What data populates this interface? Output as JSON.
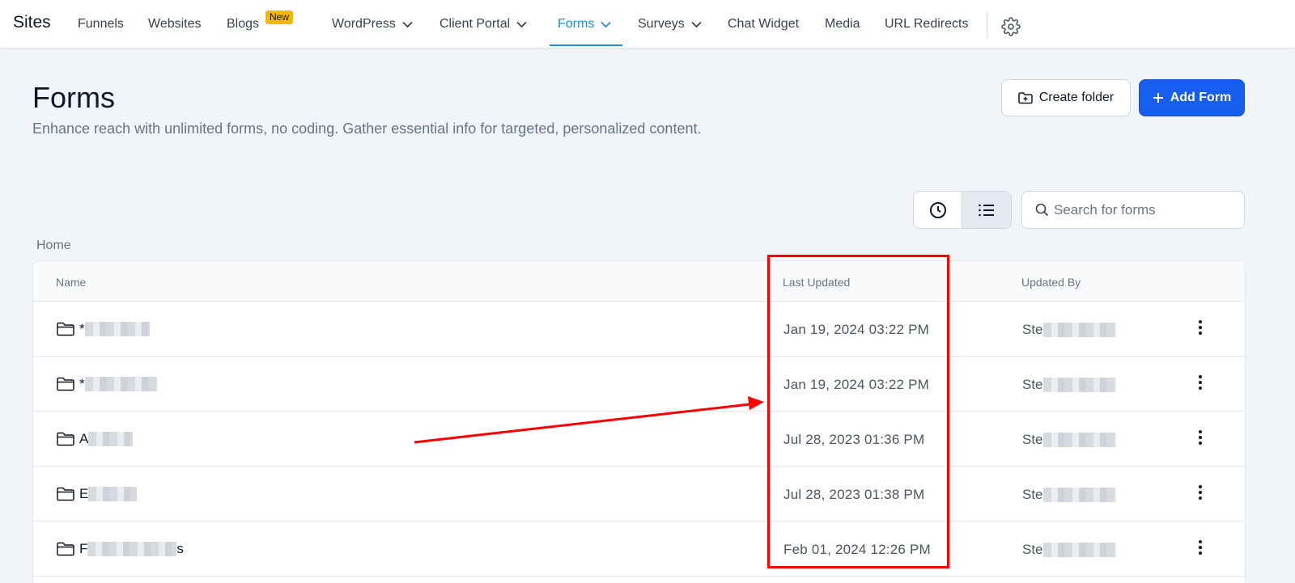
{
  "nav": {
    "brand": "Sites",
    "items": [
      {
        "label": "Funnels"
      },
      {
        "label": "Websites"
      },
      {
        "label": "Blogs",
        "badge": "New"
      },
      {
        "label": "WordPress"
      },
      {
        "label": "Client Portal"
      },
      {
        "label": "Forms"
      },
      {
        "label": "Surveys"
      },
      {
        "label": "Chat Widget"
      },
      {
        "label": "Media"
      },
      {
        "label": "URL Redirects"
      }
    ],
    "active": "Forms",
    "settings_icon": "gear-icon"
  },
  "header": {
    "title": "Forms",
    "subtitle": "Enhance reach with unlimited forms, no coding. Gather essential info for targeted, personalized content.",
    "create_folder_label": "Create folder",
    "add_form_label": "Add Form"
  },
  "search": {
    "placeholder": "Search for forms"
  },
  "breadcrumb": "Home",
  "table": {
    "columns": [
      "Name",
      "Last Updated",
      "Updated By"
    ],
    "rows": [
      {
        "name_prefix": "*",
        "last_updated": "Jan 19, 2024 03:22 PM",
        "updated_by_prefix": "Ste"
      },
      {
        "name_prefix": "*",
        "last_updated": "Jan 19, 2024 03:22 PM",
        "updated_by_prefix": "Ste"
      },
      {
        "name_prefix": "A",
        "last_updated": "Jul 28, 2023 01:36 PM",
        "updated_by_prefix": "Ste"
      },
      {
        "name_prefix": "E",
        "last_updated": "Jul 28, 2023 01:38 PM",
        "updated_by_prefix": "Ste"
      },
      {
        "name_prefix": "F",
        "name_suffix": "s",
        "last_updated": "Feb 01, 2024 12:26 PM",
        "updated_by_prefix": "Ste"
      }
    ]
  },
  "colors": {
    "accent": "#1a8ee0",
    "primary_button": "#155eef",
    "annotation": "#ff0000",
    "badge": "#f5b800"
  }
}
